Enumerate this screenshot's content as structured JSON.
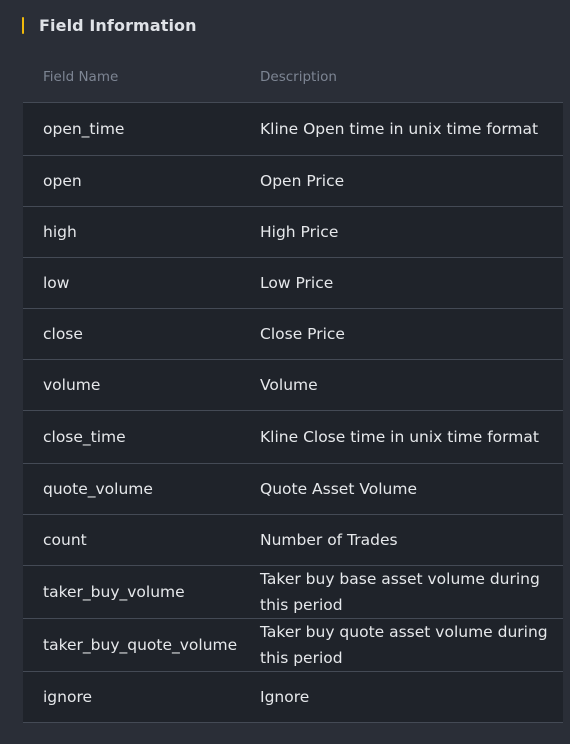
{
  "section": {
    "title": "Field Information"
  },
  "table": {
    "headers": [
      "Field Name",
      "Description"
    ],
    "rows": [
      {
        "field": "open_time",
        "description": "Kline Open time in unix time format"
      },
      {
        "field": "open",
        "description": "Open Price"
      },
      {
        "field": "high",
        "description": "High Price"
      },
      {
        "field": "low",
        "description": "Low Price"
      },
      {
        "field": "close",
        "description": "Close Price"
      },
      {
        "field": "volume",
        "description": "Volume"
      },
      {
        "field": "close_time",
        "description": "Kline Close time in unix time format"
      },
      {
        "field": "quote_volume",
        "description": "Quote Asset Volume"
      },
      {
        "field": "count",
        "description": "Number of Trades"
      },
      {
        "field": "taker_buy_volume",
        "description": "Taker buy base asset volume during this period"
      },
      {
        "field": "taker_buy_quote_volume",
        "description": "Taker buy quote asset volume during this period"
      },
      {
        "field": "ignore",
        "description": "Ignore"
      }
    ]
  },
  "colors": {
    "accent": "#f0b90b",
    "page_background": "#2a2e37",
    "row_background": "#1f232a"
  }
}
